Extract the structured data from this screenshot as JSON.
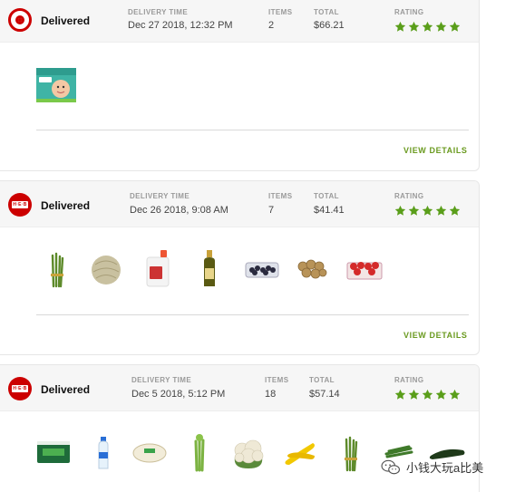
{
  "colors": {
    "accent": "#5a9e1a",
    "brand_red": "#cc0000"
  },
  "labels": {
    "delivery_time": "DELIVERY TIME",
    "items": "ITEMS",
    "total": "TOTAL",
    "rating": "RATING",
    "view_details": "VIEW DETAILS"
  },
  "orders": [
    {
      "store_icon": "target-logo-icon",
      "status": "Delivered",
      "delivery_time": "Dec 27 2018, 12:32 PM",
      "items": "2",
      "total": "$66.21",
      "rating": 5,
      "products": [
        "pampers-diapers-box"
      ]
    },
    {
      "store_icon": "heb-logo-icon",
      "status": "Delivered",
      "delivery_time": "Dec 26 2018, 9:08 AM",
      "items": "7",
      "total": "$41.41",
      "rating": 5,
      "products": [
        "asparagus",
        "cantaloupe",
        "milk-gallon",
        "olive-oil-bottle",
        "blackberries",
        "bagel-chips",
        "strawberries"
      ]
    },
    {
      "store_icon": "heb-logo-icon",
      "status": "Delivered",
      "delivery_time": "Dec 5 2018, 5:12 PM",
      "items": "18",
      "total": "$57.14",
      "rating": 5,
      "products": [
        "yogurt-pack",
        "water-bottle",
        "tortilla-pack",
        "celery",
        "cauliflower",
        "yellow-squash",
        "asparagus",
        "green-beans",
        "zucchini"
      ]
    }
  ],
  "watermark": {
    "text": "小钱大玩a比美"
  }
}
